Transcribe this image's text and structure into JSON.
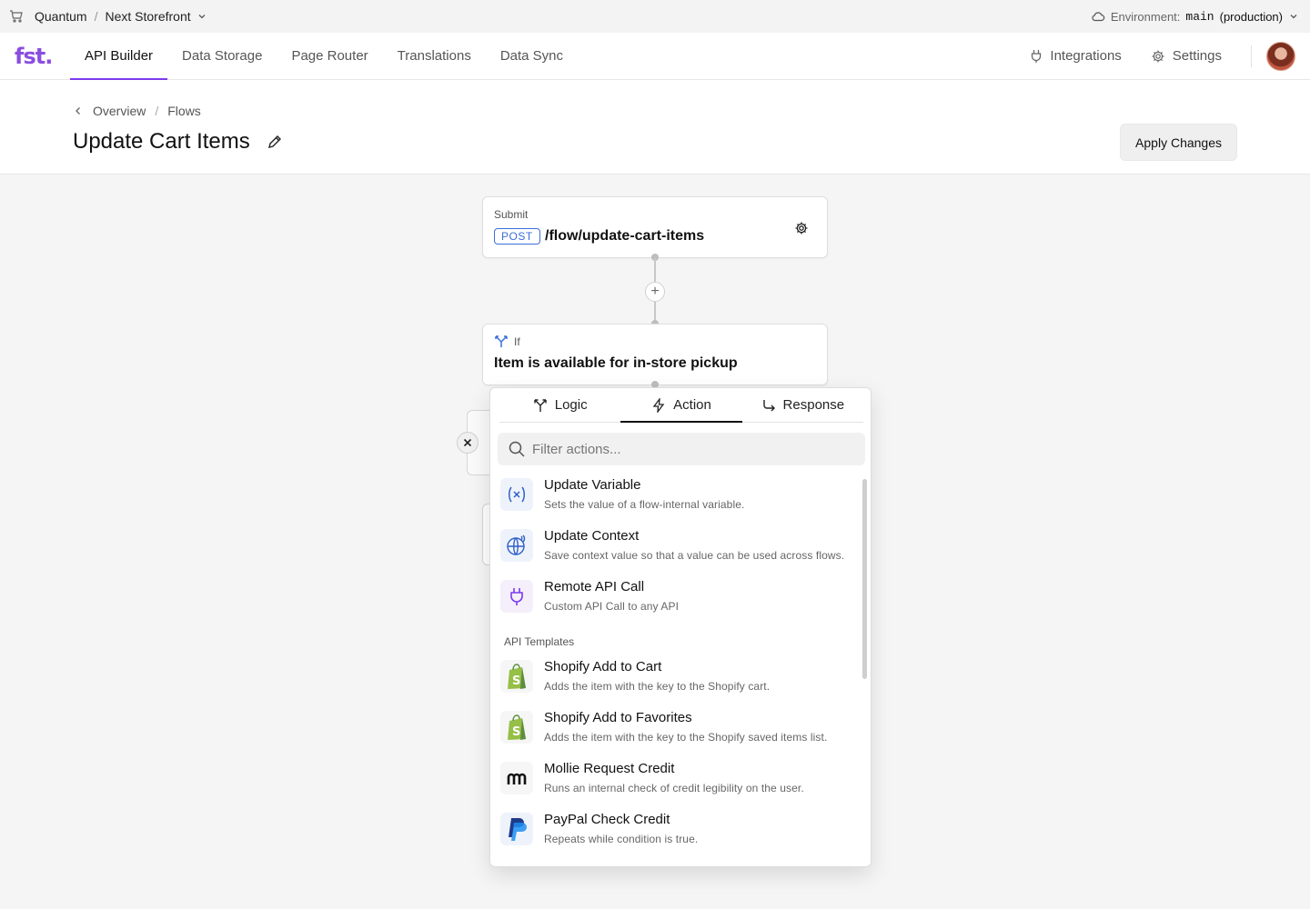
{
  "topbar": {
    "workspace": "Quantum",
    "separator": "/",
    "project": "Next Storefront",
    "env_label": "Environment:",
    "env_value": "main",
    "env_suffix": "(production)"
  },
  "nav": {
    "logo": "fst",
    "tabs": [
      "API Builder",
      "Data Storage",
      "Page Router",
      "Translations",
      "Data Sync"
    ],
    "active_tab": "API Builder",
    "integrations": "Integrations",
    "settings": "Settings"
  },
  "header": {
    "breadcrumb": [
      "Overview",
      "Flows"
    ],
    "title": "Update Cart Items",
    "apply_label": "Apply Changes"
  },
  "flow": {
    "submit": {
      "caption": "Submit",
      "method": "POST",
      "path": "/flow/update-cart-items"
    },
    "if_node": {
      "caption": "If",
      "title": "Item is available for in-store pickup"
    }
  },
  "popover": {
    "tabs": [
      "Logic",
      "Action",
      "Response"
    ],
    "active_tab": "Action",
    "filter_placeholder": "Filter actions...",
    "section_label": "API Templates",
    "actions": [
      {
        "title": "Update Variable",
        "desc": "Sets the value of a flow-internal variable.",
        "icon": "variable-icon"
      },
      {
        "title": "Update Context",
        "desc": "Save context value so that a value can be used across flows.",
        "icon": "globe-icon"
      },
      {
        "title": "Remote API Call",
        "desc": "Custom API Call to any API",
        "icon": "plug-icon"
      }
    ],
    "templates": [
      {
        "title": "Shopify Add to Cart",
        "desc": "Adds the item with the key to the Shopify cart.",
        "icon": "shopify-icon"
      },
      {
        "title": "Shopify Add to Favorites",
        "desc": "Adds the item with the key to the Shopify saved items list.",
        "icon": "shopify-icon"
      },
      {
        "title": "Mollie Request Credit",
        "desc": "Runs an internal check of credit legibility on the user.",
        "icon": "mollie-icon"
      },
      {
        "title": "PayPal Check Credit",
        "desc": "Repeats while condition is true.",
        "icon": "paypal-icon"
      }
    ]
  },
  "colors": {
    "accent": "#7c3aed",
    "badge": "#3b6fd8",
    "shopify": "#95bf47",
    "paypal": "#1f5bd8"
  }
}
